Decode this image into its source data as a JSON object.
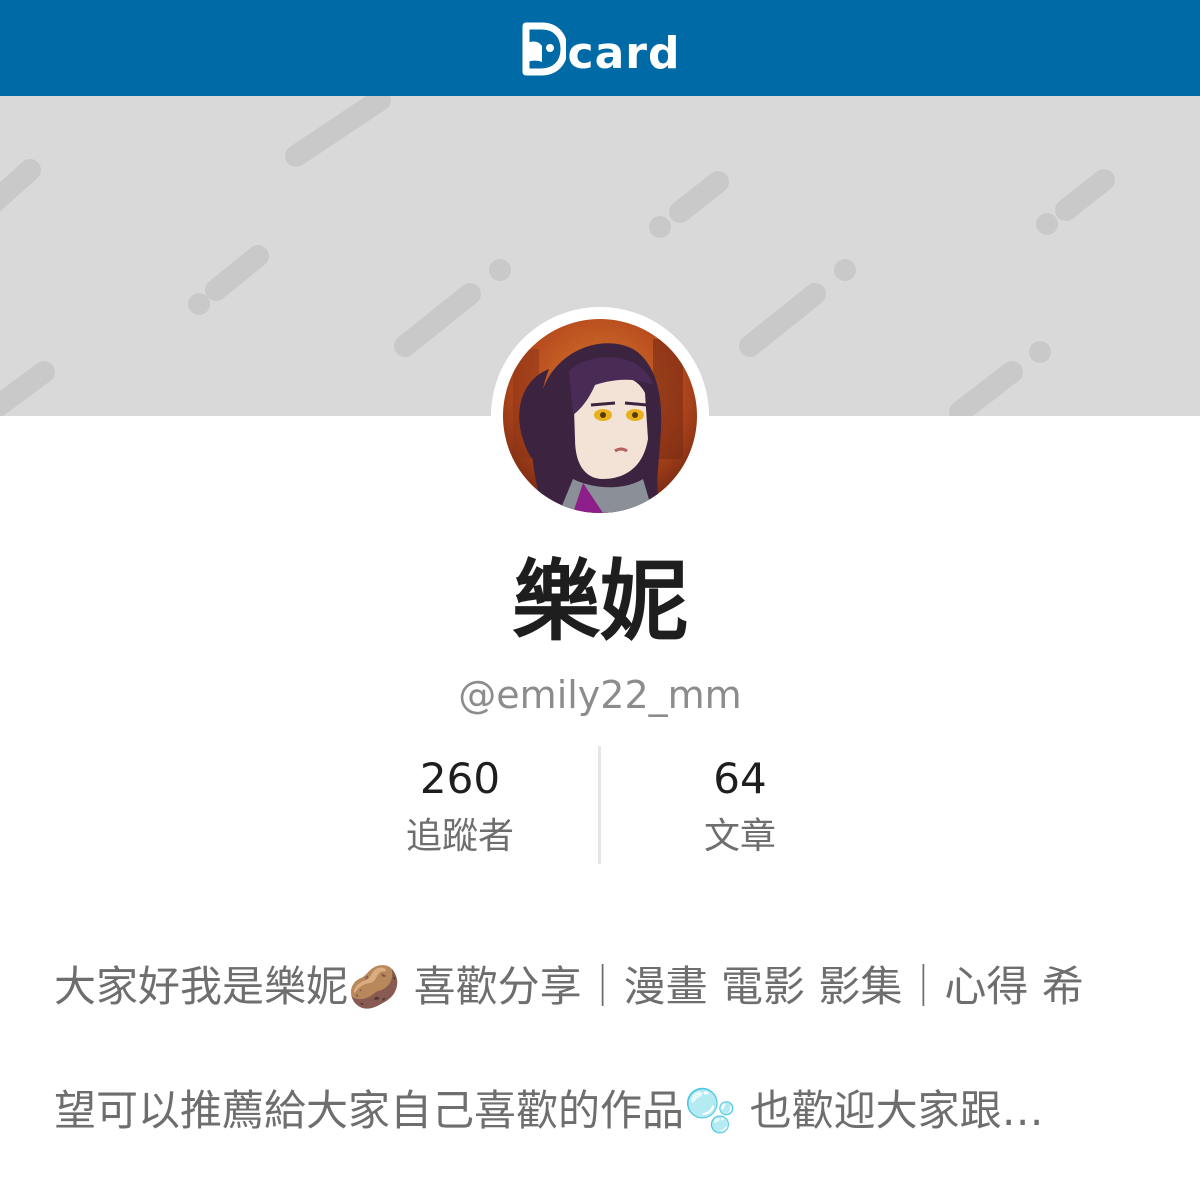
{
  "app": {
    "brand": "card",
    "brand_color": "#006aa6"
  },
  "profile": {
    "display_name": "樂妮",
    "username": "@emily22_mm",
    "avatar_icon": "anime-girl-avatar"
  },
  "stats": [
    {
      "number": "260",
      "label": "追蹤者"
    },
    {
      "number": "64",
      "label": "文章"
    }
  ],
  "bio": {
    "line1": "大家好我是樂妮🥔 喜歡分享｜漫畫 電影 影集｜心得 希",
    "line2": "望可以推薦給大家自己喜歡的作品🫧 也歡迎大家跟…"
  }
}
